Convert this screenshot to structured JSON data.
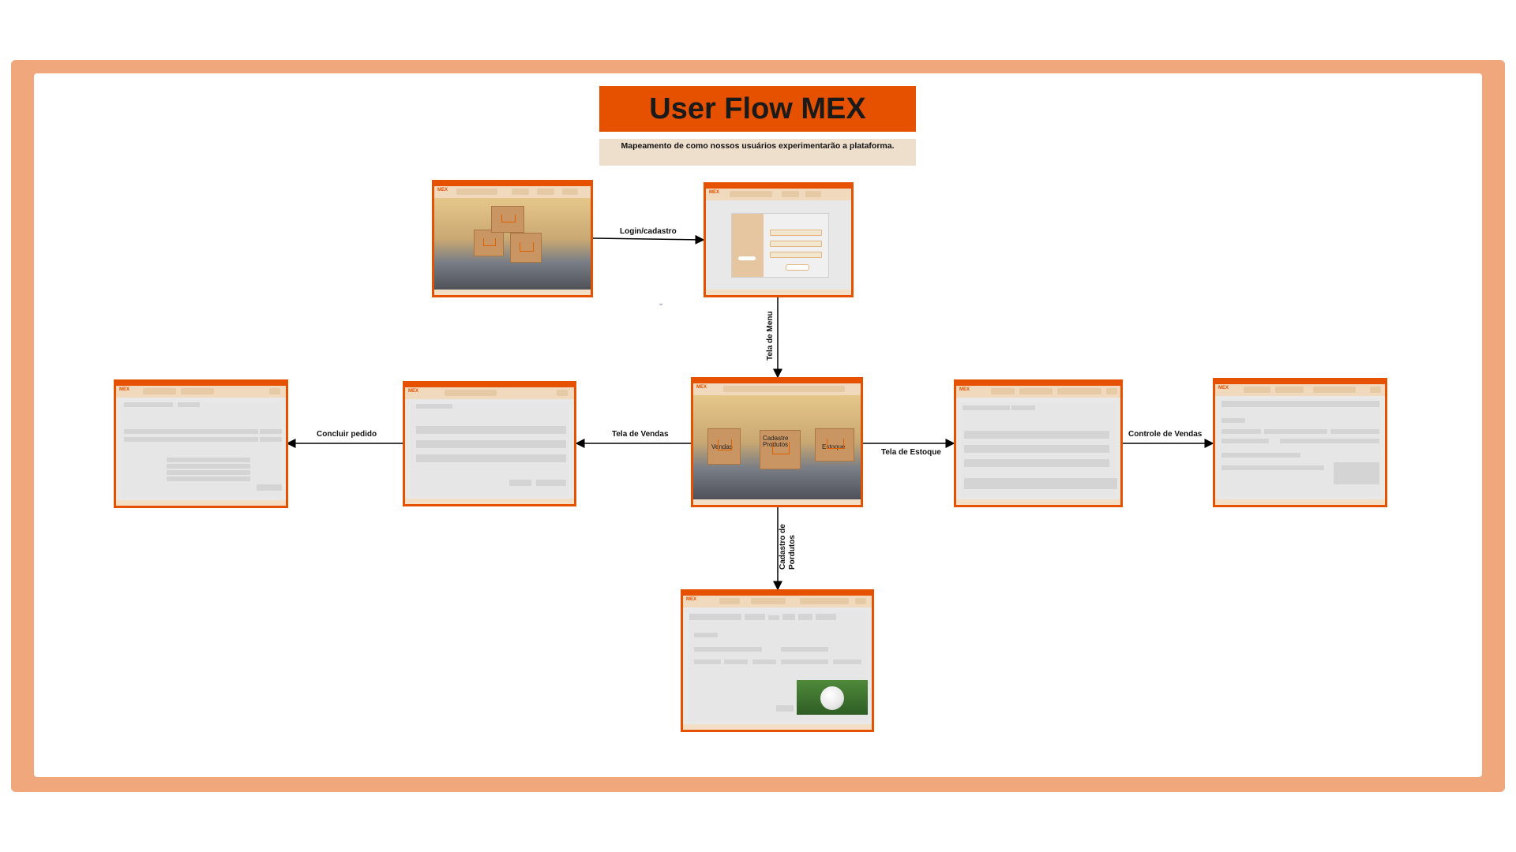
{
  "diagram": {
    "title": "User Flow MEX",
    "subtitle": "Mapeamento de como nossos usuários experimentarão a plataforma."
  },
  "edges": [
    {
      "from": "screen-home",
      "to": "screen-login",
      "label": "Login/cadastro"
    },
    {
      "from": "screen-login",
      "to": "screen-menu",
      "label": "Tela de Menu"
    },
    {
      "from": "screen-menu",
      "to": "screen-sales",
      "label": "Tela de Vendas"
    },
    {
      "from": "screen-sales",
      "to": "screen-checkout",
      "label": "Concluir pedido"
    },
    {
      "from": "screen-menu",
      "to": "screen-stock",
      "label": "Tela de Estoque"
    },
    {
      "from": "screen-stock",
      "to": "screen-sales-control",
      "label": "Controle de Vendas"
    },
    {
      "from": "screen-menu",
      "to": "screen-product-register",
      "label": "Cadastro de\nPordutos"
    }
  ],
  "screens": {
    "menu_cards": [
      "Vendas",
      "Cadastre Produtos",
      "Estoque"
    ]
  },
  "colors": {
    "frame": "#f0a77c",
    "accent": "#e65100",
    "subtitle_bg": "#eedecc",
    "arrow": "#000000"
  }
}
